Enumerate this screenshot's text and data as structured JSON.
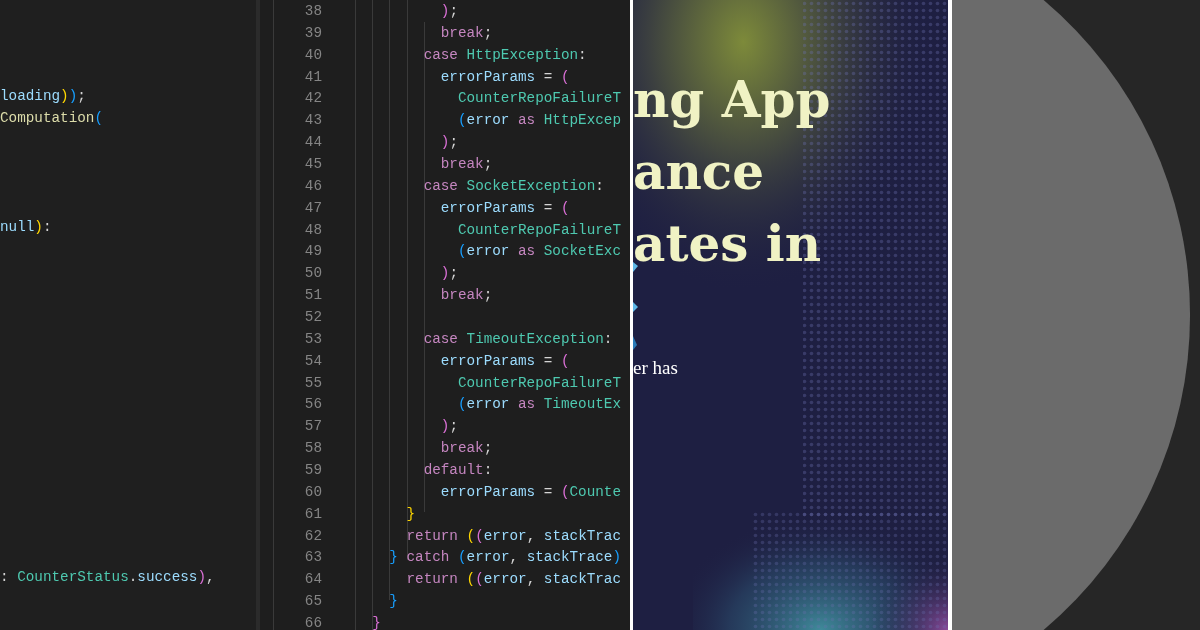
{
  "left_editor": {
    "lines": [
      {
        "tokens": [
          {
            "text": "loading",
            "color": "#9cdcfe"
          },
          {
            "text": ")",
            "color": "#ffd700"
          },
          {
            "text": ")",
            "color": "#179fff"
          },
          {
            "text": ";"
          }
        ]
      },
      {
        "tokens": [
          {
            "text": "Computation",
            "color": "#dcdcaa"
          },
          {
            "text": "(",
            "color": "#179fff"
          }
        ]
      },
      {
        "tokens": [
          {
            "text": "null",
            "color": "#9cdcfe"
          },
          {
            "text": ")",
            "color": "#ffd700"
          },
          {
            "text": ":"
          }
        ]
      },
      {
        "tokens": [
          {
            "text": ": "
          },
          {
            "text": "CounterStatus",
            "color": "#4ec9b0"
          },
          {
            "text": "."
          },
          {
            "text": "success",
            "color": "#9cdcfe"
          },
          {
            "text": ")",
            "color": "#da70d6"
          },
          {
            "text": ","
          }
        ]
      }
    ]
  },
  "code_editor": {
    "lines": [
      {
        "number": "38",
        "tokens": [
          {
            "text": "          )",
            "color": "#da70d6"
          },
          {
            "text": ";"
          }
        ]
      },
      {
        "number": "39",
        "tokens": [
          {
            "text": "          break",
            "color": "#c586c0"
          },
          {
            "text": ";"
          }
        ]
      },
      {
        "number": "40",
        "tokens": [
          {
            "text": "        case ",
            "color": "#c586c0"
          },
          {
            "text": "HttpException",
            "color": "#4ec9b0"
          },
          {
            "text": ":"
          }
        ]
      },
      {
        "number": "41",
        "tokens": [
          {
            "text": "          errorParams",
            "color": "#9cdcfe"
          },
          {
            "text": " = "
          },
          {
            "text": "(",
            "color": "#da70d6"
          }
        ]
      },
      {
        "number": "42",
        "tokens": [
          {
            "text": "            CounterRepoFailureT",
            "color": "#4ec9b0"
          }
        ]
      },
      {
        "number": "43",
        "tokens": [
          {
            "text": "            (",
            "color": "#179fff"
          },
          {
            "text": "error ",
            "color": "#9cdcfe"
          },
          {
            "text": "as ",
            "color": "#c586c0"
          },
          {
            "text": "HttpExcep",
            "color": "#4ec9b0"
          }
        ]
      },
      {
        "number": "44",
        "tokens": [
          {
            "text": "          )",
            "color": "#da70d6"
          },
          {
            "text": ";"
          }
        ]
      },
      {
        "number": "45",
        "tokens": [
          {
            "text": "          break",
            "color": "#c586c0"
          },
          {
            "text": ";"
          }
        ]
      },
      {
        "number": "46",
        "tokens": [
          {
            "text": "        case ",
            "color": "#c586c0"
          },
          {
            "text": "SocketException",
            "color": "#4ec9b0"
          },
          {
            "text": ":"
          }
        ]
      },
      {
        "number": "47",
        "tokens": [
          {
            "text": "          errorParams",
            "color": "#9cdcfe"
          },
          {
            "text": " = "
          },
          {
            "text": "(",
            "color": "#da70d6"
          }
        ]
      },
      {
        "number": "48",
        "tokens": [
          {
            "text": "            CounterRepoFailureT",
            "color": "#4ec9b0"
          }
        ]
      },
      {
        "number": "49",
        "tokens": [
          {
            "text": "            (",
            "color": "#179fff"
          },
          {
            "text": "error ",
            "color": "#9cdcfe"
          },
          {
            "text": "as ",
            "color": "#c586c0"
          },
          {
            "text": "SocketExc",
            "color": "#4ec9b0"
          }
        ]
      },
      {
        "number": "50",
        "tokens": [
          {
            "text": "          )",
            "color": "#da70d6"
          },
          {
            "text": ";"
          }
        ]
      },
      {
        "number": "51",
        "tokens": [
          {
            "text": "          break",
            "color": "#c586c0"
          },
          {
            "text": ";"
          }
        ]
      },
      {
        "number": "52"
      },
      {
        "number": "53",
        "tokens": [
          {
            "text": "        case ",
            "color": "#c586c0"
          },
          {
            "text": "TimeoutException",
            "color": "#4ec9b0"
          },
          {
            "text": ":"
          }
        ]
      },
      {
        "number": "54",
        "tokens": [
          {
            "text": "          errorParams",
            "color": "#9cdcfe"
          },
          {
            "text": " = "
          },
          {
            "text": "(",
            "color": "#da70d6"
          }
        ]
      },
      {
        "number": "55",
        "tokens": [
          {
            "text": "            CounterRepoFailureT",
            "color": "#4ec9b0"
          }
        ]
      },
      {
        "number": "56",
        "tokens": [
          {
            "text": "            (",
            "color": "#179fff"
          },
          {
            "text": "error ",
            "color": "#9cdcfe"
          },
          {
            "text": "as ",
            "color": "#c586c0"
          },
          {
            "text": "TimeoutEx",
            "color": "#4ec9b0"
          }
        ]
      },
      {
        "number": "57",
        "tokens": [
          {
            "text": "          )",
            "color": "#da70d6"
          },
          {
            "text": ";"
          }
        ]
      },
      {
        "number": "58",
        "tokens": [
          {
            "text": "          break",
            "color": "#c586c0"
          },
          {
            "text": ";"
          }
        ]
      },
      {
        "number": "59",
        "tokens": [
          {
            "text": "        default",
            "color": "#c586c0"
          },
          {
            "text": ":"
          }
        ]
      },
      {
        "number": "60",
        "tokens": [
          {
            "text": "          errorParams",
            "color": "#9cdcfe"
          },
          {
            "text": " = "
          },
          {
            "text": "(",
            "color": "#da70d6"
          },
          {
            "text": "Counte",
            "color": "#4ec9b0"
          }
        ]
      },
      {
        "number": "61",
        "tokens": [
          {
            "text": "      }",
            "color": "#ffd700"
          }
        ]
      },
      {
        "number": "62",
        "tokens": [
          {
            "text": "      return ",
            "color": "#c586c0"
          },
          {
            "text": "(",
            "color": "#ffd700"
          },
          {
            "text": "(",
            "color": "#da70d6"
          },
          {
            "text": "error",
            "color": "#9cdcfe"
          },
          {
            "text": ", "
          },
          {
            "text": "stackTrac",
            "color": "#9cdcfe"
          }
        ]
      },
      {
        "number": "63",
        "tokens": [
          {
            "text": "    }",
            "color": "#179fff"
          },
          {
            "text": " catch ",
            "color": "#c586c0"
          },
          {
            "text": "(",
            "color": "#179fff"
          },
          {
            "text": "error",
            "color": "#9cdcfe"
          },
          {
            "text": ", "
          },
          {
            "text": "stackTrace",
            "color": "#9cdcfe"
          },
          {
            "text": ")",
            "color": "#179fff"
          }
        ]
      },
      {
        "number": "64",
        "tokens": [
          {
            "text": "      return ",
            "color": "#c586c0"
          },
          {
            "text": "(",
            "color": "#ffd700"
          },
          {
            "text": "(",
            "color": "#da70d6"
          },
          {
            "text": "error",
            "color": "#9cdcfe"
          },
          {
            "text": ", "
          },
          {
            "text": "stackTrac",
            "color": "#9cdcfe"
          }
        ]
      },
      {
        "number": "65",
        "tokens": [
          {
            "text": "    }",
            "color": "#179fff"
          }
        ]
      },
      {
        "number": "66",
        "tokens": [
          {
            "text": "  }",
            "color": "#da70d6"
          }
        ]
      }
    ]
  },
  "article_banner": {
    "kind": "picture",
    "title_lines": [
      "ng App",
      "ance",
      "ates in"
    ],
    "subtitle": "er has"
  }
}
